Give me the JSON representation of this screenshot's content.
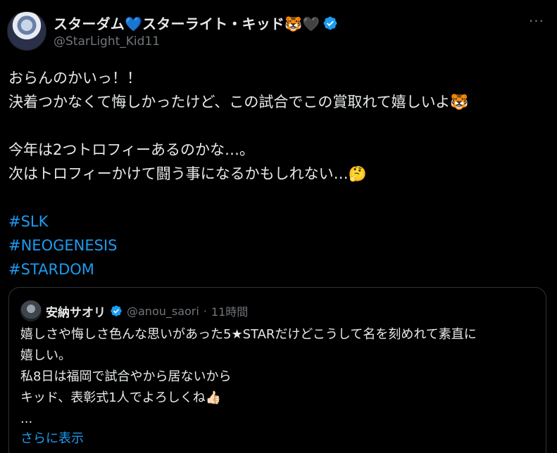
{
  "author": {
    "display_name": "スターダム💙スターライト・キッド🐯🖤",
    "handle": "@StarLight_Kid11"
  },
  "menu": {
    "more_icon": "···"
  },
  "tweet": {
    "lines": [
      "おらんのかいっ！！",
      "決着つかなくて悔しかったけど、この試合でこの賞取れて嬉しいよ🐯",
      "",
      "今年は2つトロフィーあるのかな…。",
      "次はトロフィーかけて闘う事になるかもしれない…🤔"
    ],
    "hashtags": [
      "#SLK",
      "#NEOGENESIS",
      "#STARDOM"
    ]
  },
  "quote": {
    "display_name": "安納サオリ",
    "handle": "@anou_saori",
    "separator": "·",
    "time": "11時間",
    "lines": [
      "嬉しさや悔しさ色んな思いがあった5★STARだけどこうして名を刻めれて素直に",
      "嬉しい。",
      "私8日は福岡で試合やから居ないから",
      "キッド、表彰式1人でよろしくね👍🏻",
      "..."
    ],
    "show_more": "さらに表示"
  },
  "colors": {
    "background": "#000000",
    "text": "#e7e9ea",
    "secondary": "#71767b",
    "accent": "#1d9bf0",
    "border": "#2f3336"
  }
}
